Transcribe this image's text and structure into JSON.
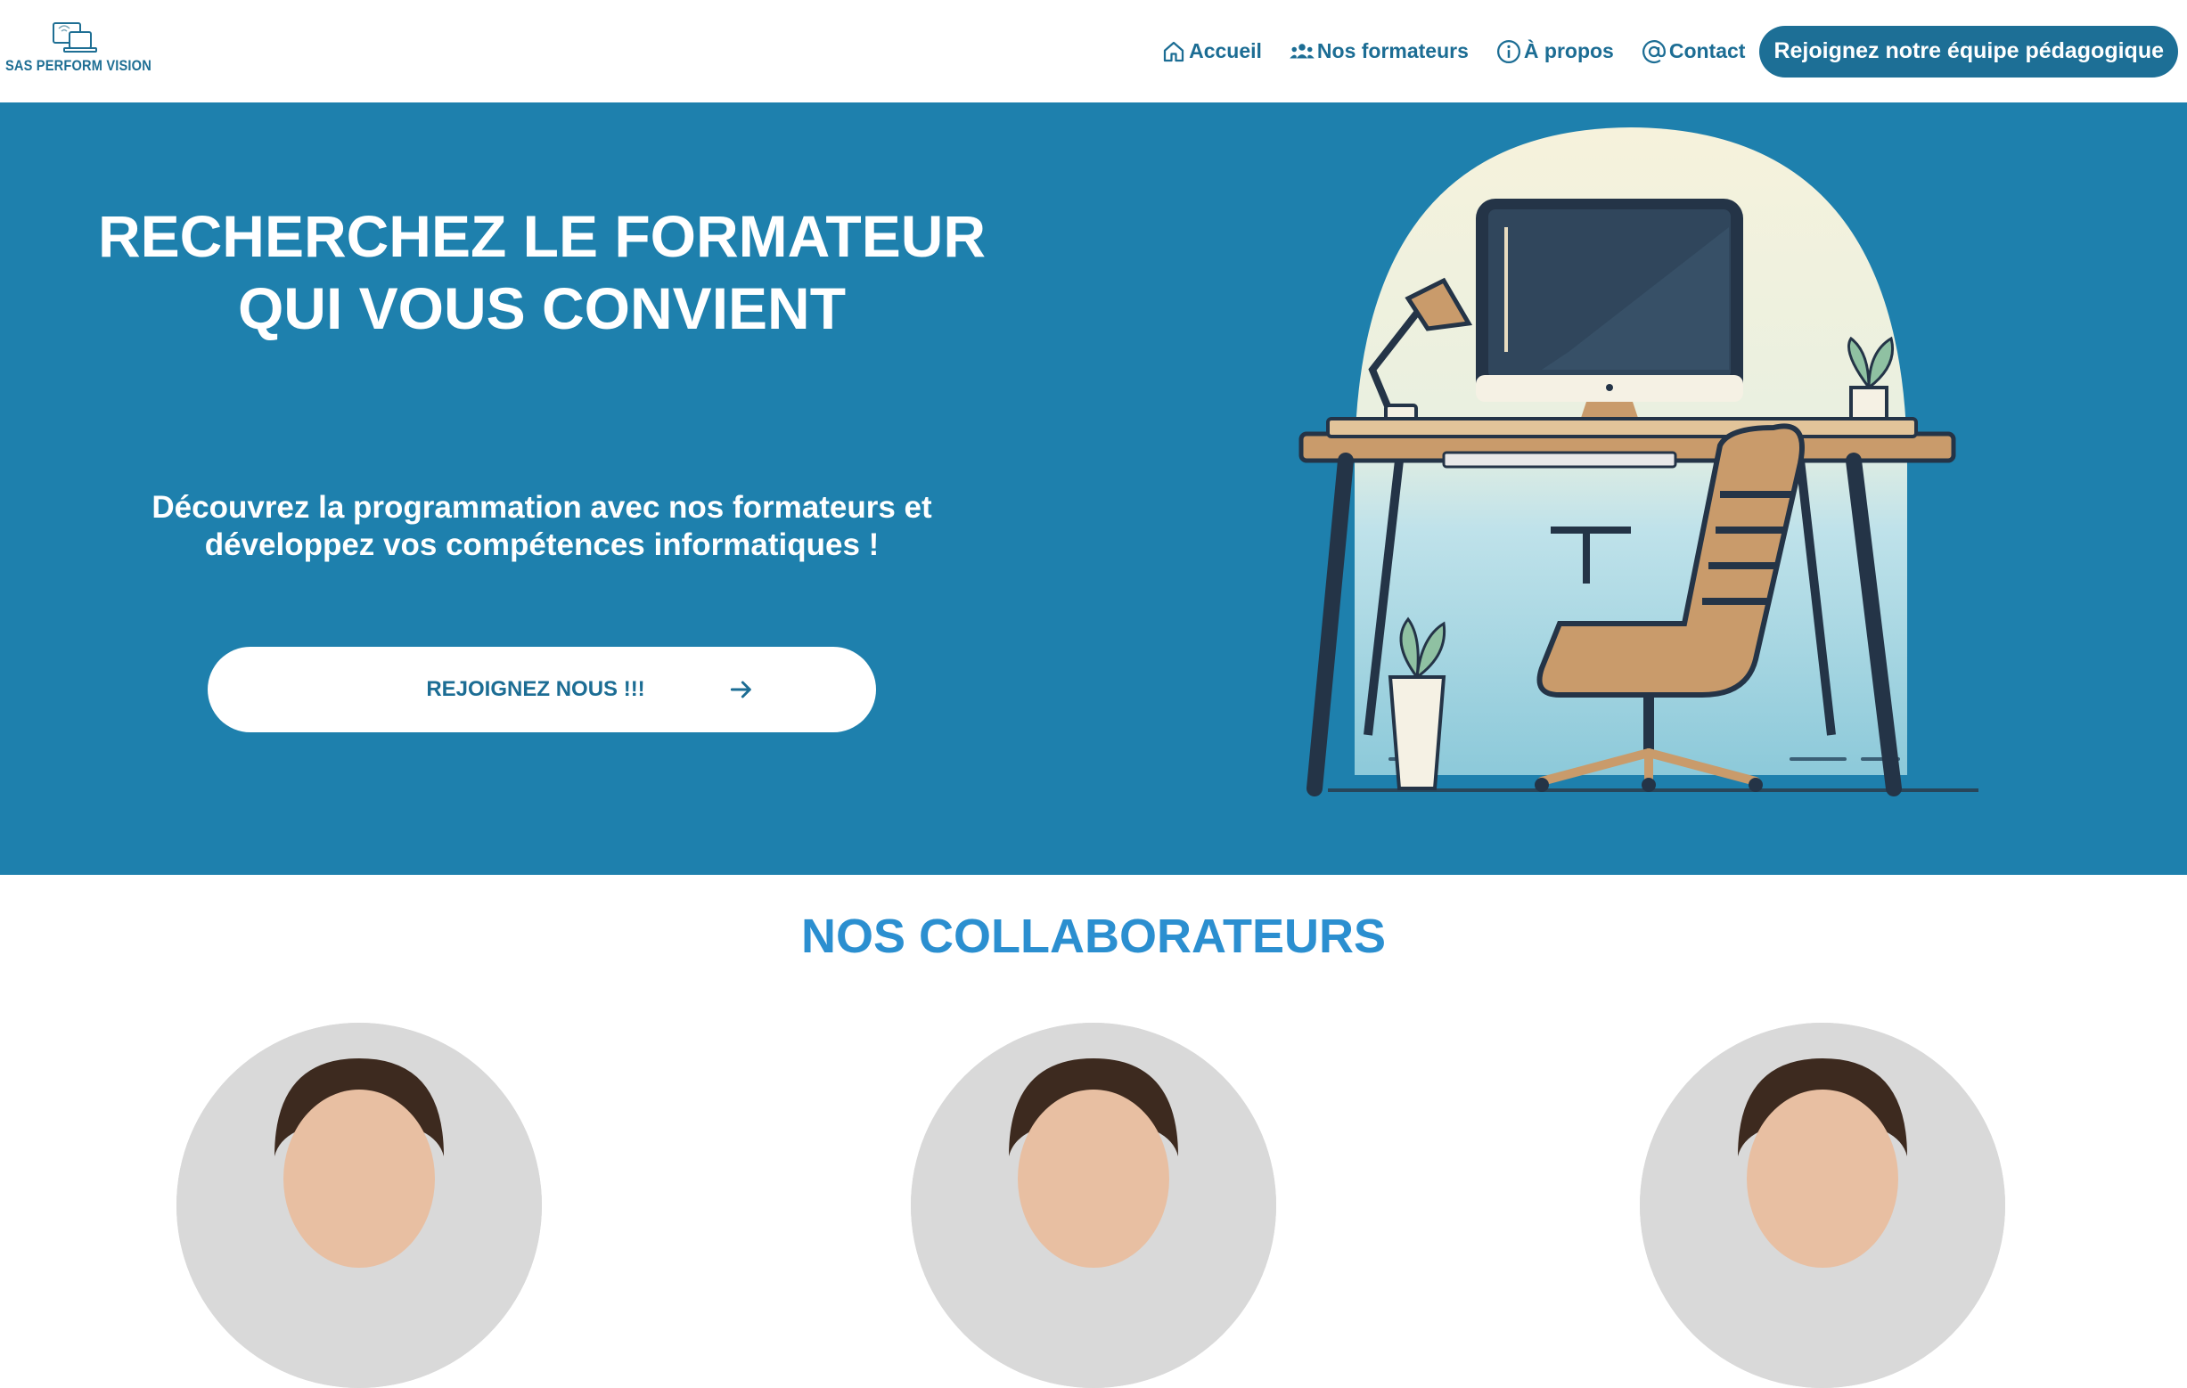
{
  "logo": {
    "text": "SAS PERFORM VISION",
    "icon": "devices-logo-icon"
  },
  "nav": {
    "items": [
      {
        "label": "Accueil",
        "icon": "home-icon"
      },
      {
        "label": "Nos formateurs",
        "icon": "users-icon"
      },
      {
        "label": "À propos",
        "icon": "info-icon"
      },
      {
        "label": "Contact",
        "icon": "at-icon"
      }
    ],
    "cta_label": "Rejoignez notre équipe pédagogique"
  },
  "hero": {
    "title": "RECHERCHEZ LE FORMATEUR QUI VOUS CONVIENT",
    "subtitle": "Découvrez la programmation avec nos formateurs et développez vos compétences informatiques !",
    "button_label": "REJOIGNEZ NOUS !!!",
    "button_icon": "arrow-right-icon",
    "illustration": "desk-workspace-illustration"
  },
  "collaborators": {
    "title": "NOS COLLABORATEURS",
    "count_visible": 3
  },
  "colors": {
    "primary": "#1e80ad",
    "nav_text": "#1c6d94",
    "cta_bg": "#1d6f96",
    "section_title": "#2b8fd0"
  }
}
